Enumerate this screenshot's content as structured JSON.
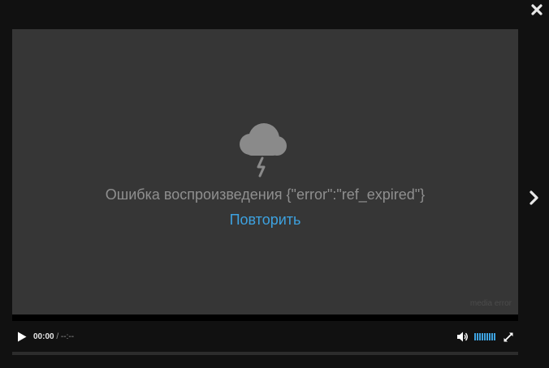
{
  "lightbox": {
    "close_icon": "close-icon",
    "next_icon": "chevron-right-icon"
  },
  "player": {
    "error_icon": "storm-cloud-icon",
    "error_message": "Ошибка воспроизведения {\"error\":\"ref_expired\"}",
    "retry_label": "Повторить",
    "watermark": "media error",
    "progress": 0
  },
  "controls": {
    "play_icon": "play-icon",
    "current_time": "00:00",
    "separator": " / ",
    "duration": "--:--",
    "volume_icon": "speaker-icon",
    "volume_level": 1.0,
    "fullscreen_icon": "fullscreen-icon"
  },
  "colors": {
    "accent": "#3da2e0",
    "screen_bg": "#363636",
    "page_bg": "#111111",
    "error_text": "#8f8f8f"
  }
}
